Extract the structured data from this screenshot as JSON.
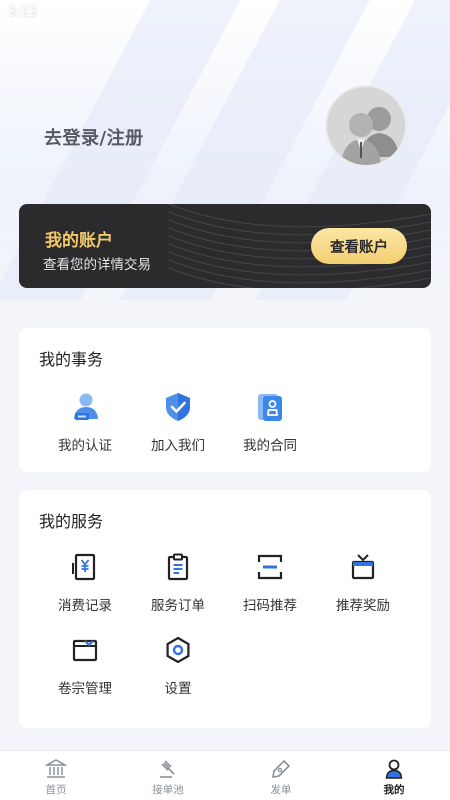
{
  "status_bar": {
    "time": "3:23"
  },
  "header": {
    "login_text": "去登录/注册",
    "avatar_icon": "user-avatar-icon"
  },
  "account_card": {
    "title": "我的账户",
    "subtitle": "查看您的详情交易",
    "button_label": "查看账户",
    "accent_color": "#f2c86a"
  },
  "affairs": {
    "title": "我的事务",
    "items": [
      {
        "label": "我的认证",
        "icon": "user-badge-icon"
      },
      {
        "label": "加入我们",
        "icon": "shield-check-icon"
      },
      {
        "label": "我的合同",
        "icon": "contract-icon"
      }
    ]
  },
  "services": {
    "title": "我的服务",
    "items": [
      {
        "label": "消费记录",
        "icon": "receipt-yen-icon"
      },
      {
        "label": "服务订单",
        "icon": "clipboard-list-icon"
      },
      {
        "label": "扫码推荐",
        "icon": "scan-icon"
      },
      {
        "label": "推荐奖励",
        "icon": "gift-icon"
      },
      {
        "label": "卷宗管理",
        "icon": "folder-icon"
      },
      {
        "label": "设置",
        "icon": "hex-settings-icon"
      }
    ]
  },
  "tabbar": {
    "items": [
      {
        "label": "首页",
        "icon": "bank-icon"
      },
      {
        "label": "接单池",
        "icon": "gavel-icon"
      },
      {
        "label": "发单",
        "icon": "pen-icon"
      },
      {
        "label": "我的",
        "icon": "profile-icon"
      }
    ],
    "active": "我的"
  }
}
